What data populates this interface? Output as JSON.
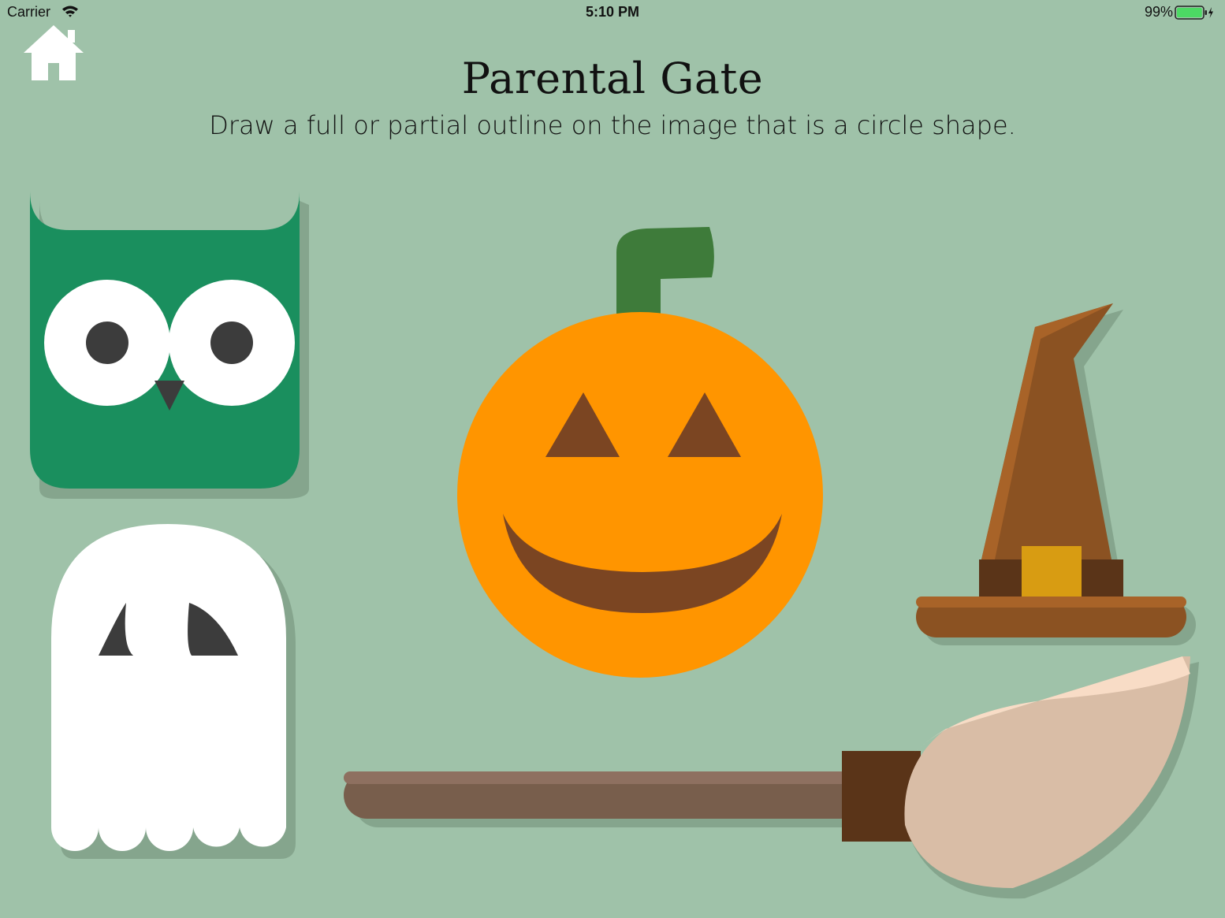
{
  "status_bar": {
    "carrier": "Carrier",
    "time": "5:10 PM",
    "battery_percent": "99%",
    "battery_level": 0.99
  },
  "header": {
    "title": "Parental Gate",
    "instructions": "Draw a full or partial outline on the image that is a circle shape."
  },
  "icons": {
    "home": "home-icon",
    "wifi": "wifi-icon",
    "battery": "battery-icon",
    "charging": "charging-bolt-icon"
  },
  "images": {
    "owl": "owl-image",
    "ghost": "ghost-image",
    "pumpkin": "pumpkin-image",
    "witch_hat": "witch-hat-image",
    "broom": "broom-image"
  },
  "colors": {
    "background": "#9fc2a9",
    "owl": "#1a8f5e",
    "pumpkin": "#ff9500",
    "pumpkin_stem": "#3e7b3a",
    "hat": "#8b5222",
    "hat_band": "#5a3418",
    "hat_buckle": "#d89c12",
    "broom_handle": "#785e4c",
    "broom_bristles": "#d9bda6",
    "face_features": "#7b4522"
  }
}
